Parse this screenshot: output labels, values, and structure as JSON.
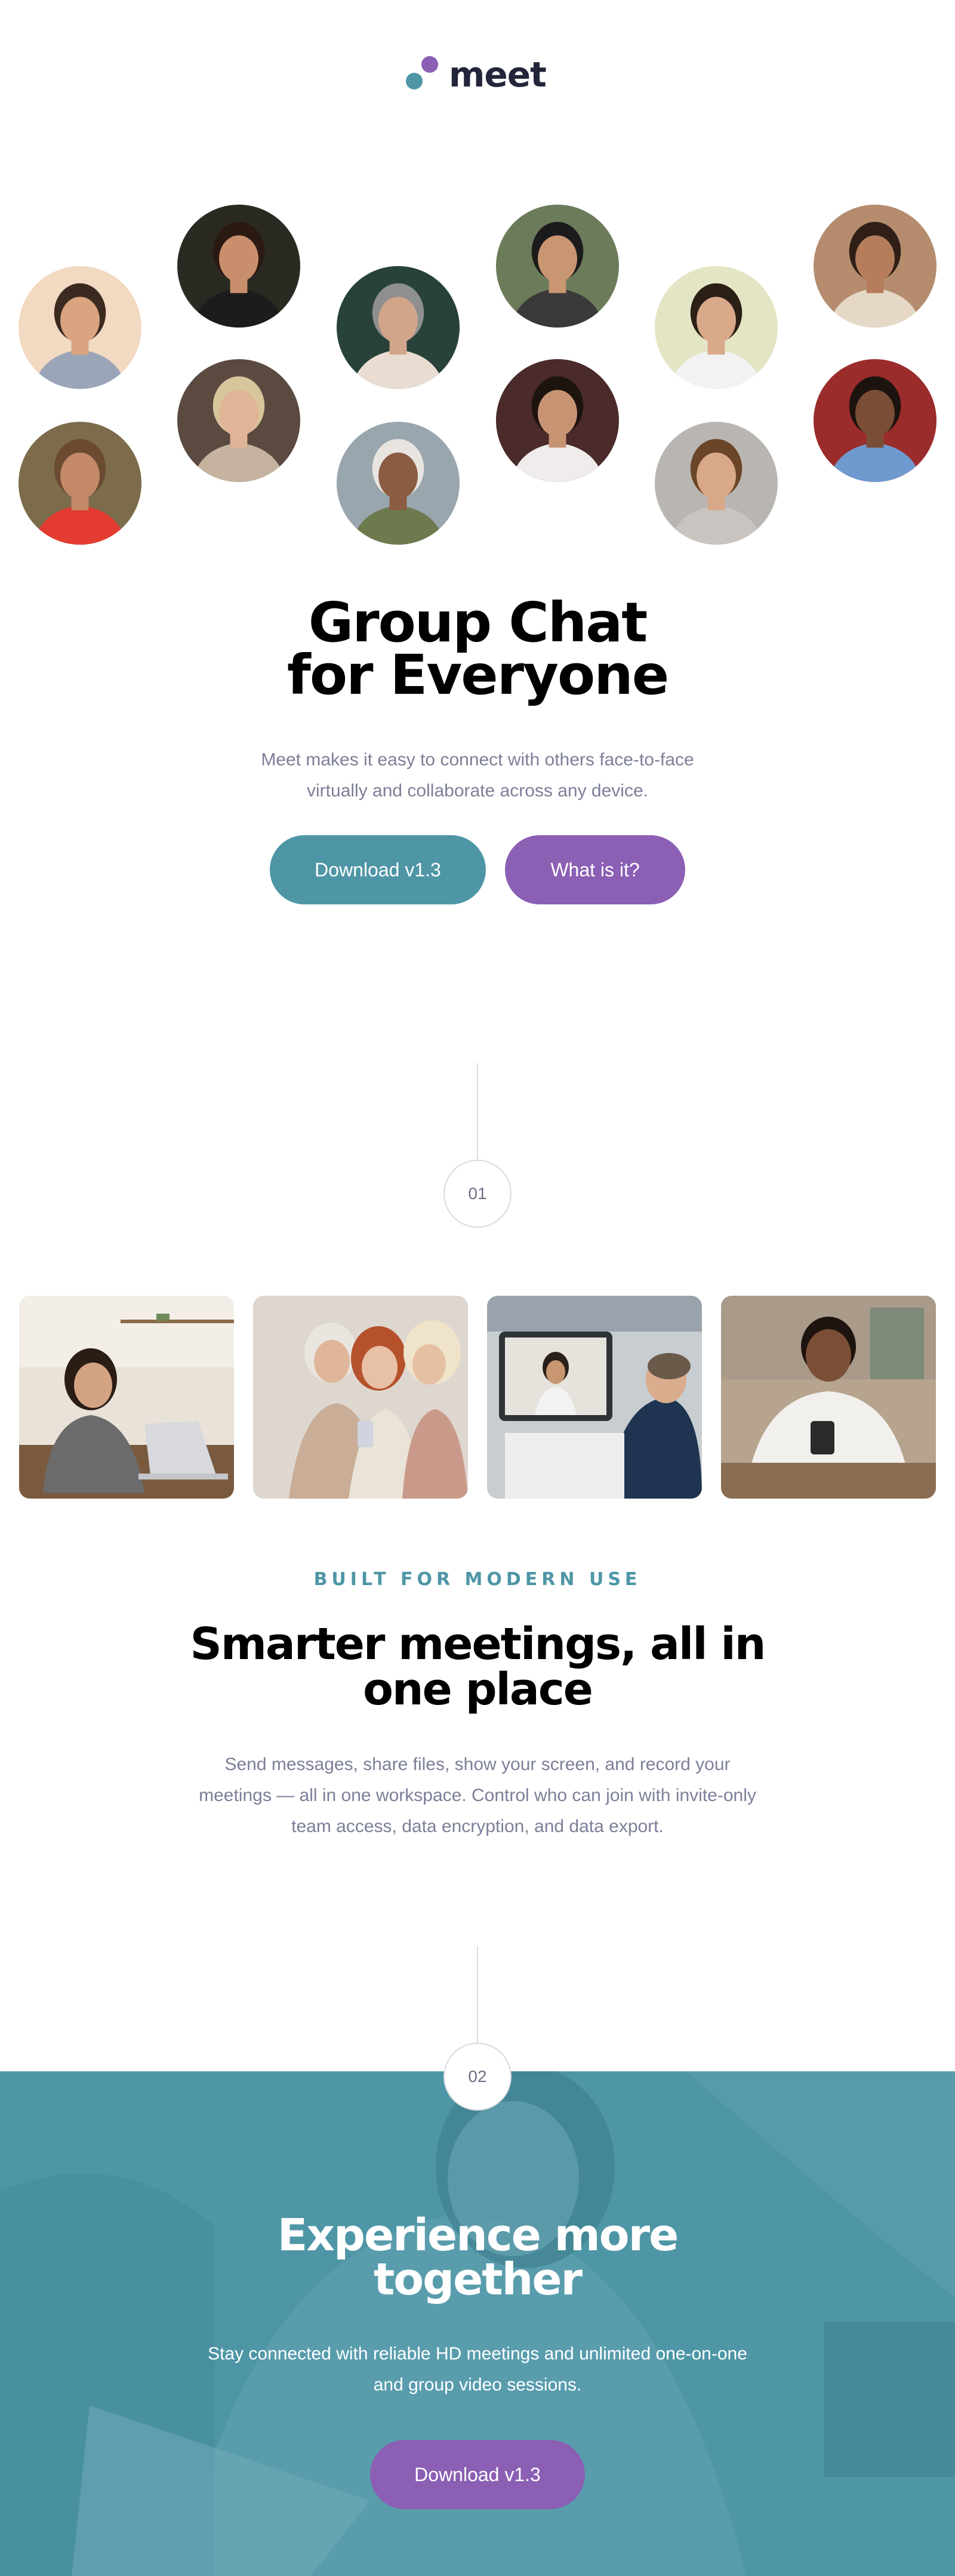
{
  "brand": {
    "name": "meet",
    "colors": {
      "teal": "#4e96a6",
      "purple": "#8b5fb4",
      "navy": "#23253a",
      "muted": "#7c7f98"
    }
  },
  "avatars": [
    {
      "name": "person-1",
      "bg": "#f2d9c2",
      "skin": "#d9a47f",
      "hair": "#3b2a1f",
      "shirt": "#9aa6b8"
    },
    {
      "name": "person-2",
      "bg": "#2b2a22",
      "skin": "#c98f6c",
      "hair": "#2a1a12",
      "shirt": "#1c1c1c"
    },
    {
      "name": "person-3",
      "bg": "#28423a",
      "skin": "#d1a58a",
      "hair": "#8f8f8f",
      "shirt": "#e8ddd0"
    },
    {
      "name": "person-4",
      "bg": "#6c7b5a",
      "skin": "#c99672",
      "hair": "#1b1b1b",
      "shirt": "#3a3a3a"
    },
    {
      "name": "person-5",
      "bg": "#e4e5c4",
      "skin": "#d9a98a",
      "hair": "#2a2015",
      "shirt": "#f2f2f2"
    },
    {
      "name": "person-6",
      "bg": "#b58d6e",
      "skin": "#b67d5d",
      "hair": "#2f1f16",
      "shirt": "#e6d8c6"
    },
    {
      "name": "person-7",
      "bg": "#7c6c4b",
      "skin": "#c48a68",
      "hair": "#6b4a32",
      "shirt": "#e33b2f"
    },
    {
      "name": "person-8",
      "bg": "#5b4a40",
      "skin": "#e0b497",
      "hair": "#d7c59c",
      "shirt": "#c5b3a0"
    },
    {
      "name": "person-9",
      "bg": "#9aa6ae",
      "skin": "#8a5c42",
      "hair": "#e8e4df",
      "shirt": "#6d7a4e"
    },
    {
      "name": "person-10",
      "bg": "#4a2a2a",
      "skin": "#c79473",
      "hair": "#1e140f",
      "shirt": "#f0ecec"
    },
    {
      "name": "person-11",
      "bg": "#b9b6b2",
      "skin": "#d8a888",
      "hair": "#6b4528",
      "shirt": "#c9c4bf"
    },
    {
      "name": "person-12",
      "bg": "#9b2c2c",
      "skin": "#7a4e36",
      "hair": "#1d130e",
      "shirt": "#6f9ad0"
    }
  ],
  "hero": {
    "title_line1": "Group Chat",
    "title_line2": "for Everyone",
    "desc_line1": "Meet makes it easy to connect with others face-to-face",
    "desc_line2": "virtually and collaborate across any device.",
    "primary_button": "Download v1.3",
    "secondary_button": "What is it?"
  },
  "steps": {
    "one": "01",
    "two": "02"
  },
  "photos": [
    {
      "name": "woman-laptop-photo"
    },
    {
      "name": "seniors-phone-photo"
    },
    {
      "name": "video-call-photo"
    },
    {
      "name": "man-phone-photo"
    }
  ],
  "features": {
    "eyebrow": "BUILT FOR MODERN USE",
    "title_line1": "Smarter meetings, all in",
    "title_line2": "one place",
    "desc_line1": "Send messages, share files, show your screen, and record your",
    "desc_line2": "meetings — all in one workspace. Control who can join with invite-only",
    "desc_line3": "team access, data encryption, and data export."
  },
  "cta": {
    "title_line1": "Experience more",
    "title_line2": "together",
    "desc_line1": "Stay connected with reliable HD meetings and unlimited one-on-one",
    "desc_line2": "and group video sessions.",
    "button": "Download v1.3"
  }
}
